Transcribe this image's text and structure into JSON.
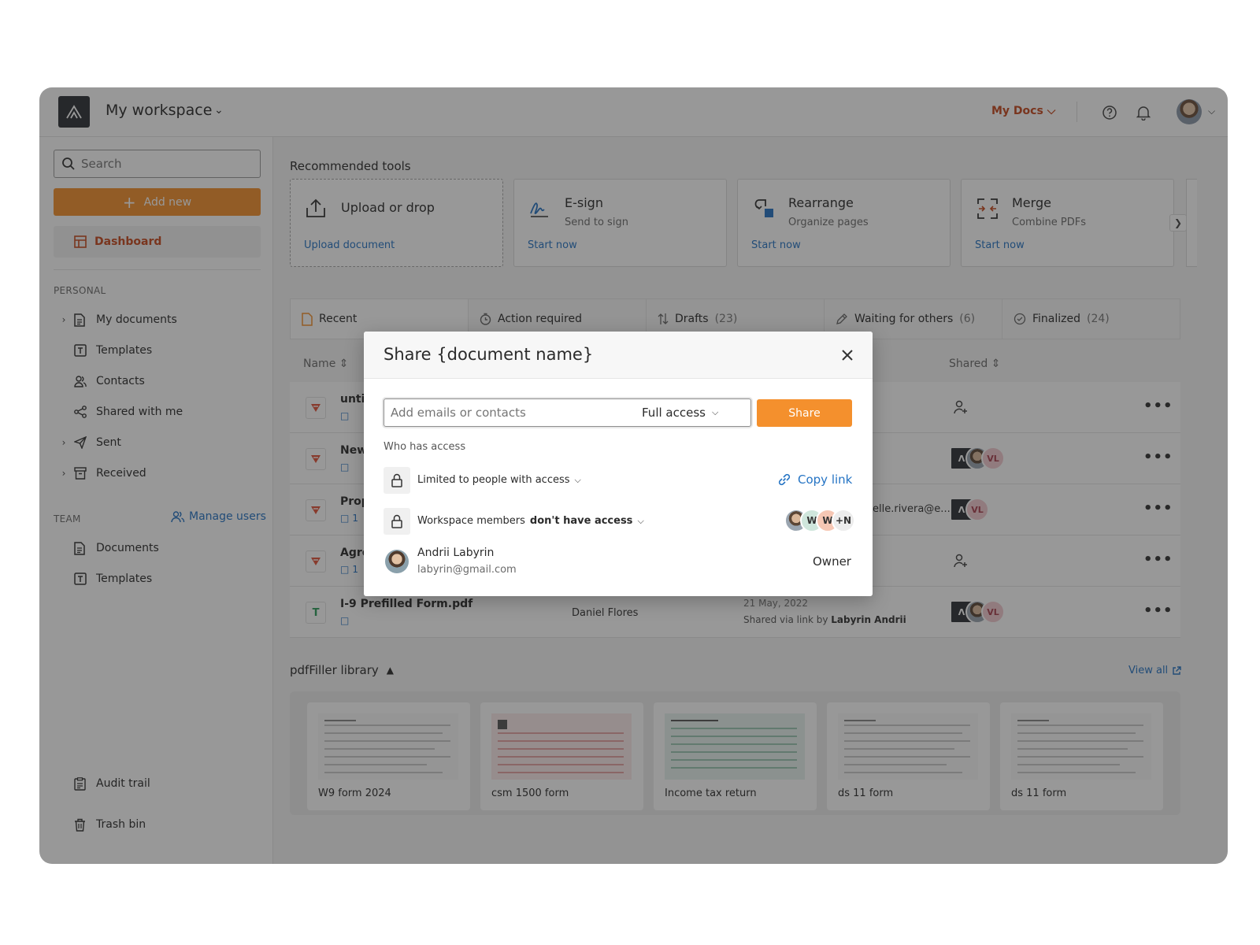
{
  "topbar": {
    "workspace_title": "My workspace",
    "mydocs_label": "My Docs"
  },
  "sidebar": {
    "search_placeholder": "Search",
    "add_new_label": "Add new",
    "dashboard_label": "Dashboard",
    "personal_heading": "PERSONAL",
    "personal_items": [
      {
        "label": "My documents",
        "icon": "document-icon",
        "expandable": true
      },
      {
        "label": "Templates",
        "icon": "template-icon",
        "expandable": false
      },
      {
        "label": "Contacts",
        "icon": "contacts-icon",
        "expandable": false
      },
      {
        "label": "Shared with me",
        "icon": "share-icon",
        "expandable": false
      },
      {
        "label": "Sent",
        "icon": "send-icon",
        "expandable": true
      },
      {
        "label": "Received",
        "icon": "inbox-icon",
        "expandable": true
      }
    ],
    "team_heading": "TEAM",
    "manage_users_label": "Manage users",
    "team_items": [
      {
        "label": "Documents",
        "icon": "document-icon"
      },
      {
        "label": "Templates",
        "icon": "template-icon"
      }
    ],
    "audit_trail_label": "Audit trail",
    "trash_bin_label": "Trash bin"
  },
  "tools": {
    "heading": "Recommended tools",
    "items": [
      {
        "title": "Upload or drop",
        "subtitle": "",
        "link": "Upload document",
        "icon": "upload-icon"
      },
      {
        "title": "E-sign",
        "subtitle": "Send to sign",
        "link": "Start now",
        "icon": "signature-icon"
      },
      {
        "title": "Rearrange",
        "subtitle": "Organize pages",
        "link": "Start now",
        "icon": "rearrange-icon"
      },
      {
        "title": "Merge",
        "subtitle": "Combine PDFs",
        "link": "Start now",
        "icon": "merge-icon"
      }
    ]
  },
  "doc_tabs": [
    {
      "label": "Recent",
      "count": "",
      "icon": "recent-icon"
    },
    {
      "label": "Action required",
      "count": "",
      "icon": "clock-icon"
    },
    {
      "label": "Drafts",
      "count": "(23)",
      "icon": "sort-icon"
    },
    {
      "label": "Waiting for others",
      "count": "(6)",
      "icon": "pen-icon"
    },
    {
      "label": "Finalized",
      "count": "(24)",
      "icon": "check-circle-icon"
    }
  ],
  "table": {
    "col_name": "Name",
    "col_shared": "Shared",
    "rows": [
      {
        "name": "unti",
        "comments": "",
        "owner": "",
        "date": "",
        "date_sub_prefix": "",
        "date_sub_name": "",
        "shared_email": "",
        "shared": "add-person"
      },
      {
        "name": "New",
        "comments": "",
        "owner": "",
        "date": "",
        "date_sub_prefix": "",
        "date_sub_name": "",
        "shared_email": "",
        "shared": "logo-photo-vl"
      },
      {
        "name": "Prop",
        "comments": "1",
        "owner": "",
        "date": "",
        "date_sub_prefix": "",
        "date_sub_name": "",
        "shared_email": "elle.rivera@e...",
        "shared": "logo-vl"
      },
      {
        "name": "Agre",
        "comments": "1",
        "owner": "",
        "date": "",
        "date_sub_prefix": "",
        "date_sub_name": "",
        "shared_email": "",
        "shared": "add-person"
      },
      {
        "name": "I-9 Prefilled Form.pdf",
        "comments": "",
        "owner": "Daniel Flores",
        "date": "21 May, 2022",
        "date_sub_prefix": "Shared via link by",
        "date_sub_name": "Labyrin Andrii",
        "shared_email": "",
        "shared": "logo-photo-vl"
      }
    ],
    "avatar_initials": "VL"
  },
  "library": {
    "title": "pdfFiller library",
    "view_all_label": "View all",
    "items": [
      {
        "name": "W9 form 2024"
      },
      {
        "name": "csm 1500 form"
      },
      {
        "name": "Income tax return"
      },
      {
        "name": "ds 11 form"
      },
      {
        "name": "ds 11 form"
      }
    ]
  },
  "share_modal": {
    "title": "Share {document name}",
    "input_placeholder": "Add emails or contacts",
    "access_level": "Full access",
    "share_button": "Share",
    "who_has_access": "Who has access",
    "limited_option": "Limited to people with access",
    "copy_link_label": "Copy link",
    "workspace_option_prefix": "Workspace members",
    "workspace_option_bold": "don't have access",
    "member_avatars": [
      "W",
      "W",
      "+N"
    ],
    "owner": {
      "name": "Andrii Labyrin",
      "email": "labyrin@gmail.com",
      "role": "Owner"
    }
  },
  "colors": {
    "accent_orange": "#f4902d",
    "brand_red": "#c6491f",
    "link_blue": "#2574c4"
  }
}
